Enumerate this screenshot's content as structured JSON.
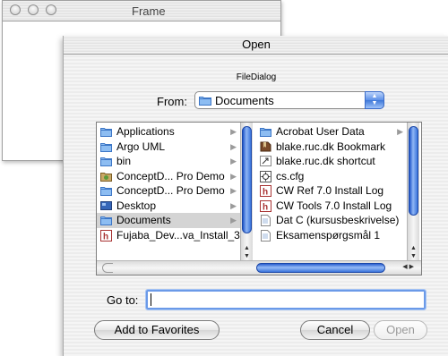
{
  "background_window": {
    "title": "Frame"
  },
  "dialog": {
    "title": "Open",
    "subtitle": "FileDialog",
    "from_label": "From:",
    "from_value": "Documents",
    "goto_label": "Go to:",
    "goto_value": "",
    "buttons": {
      "add_favorites": "Add to Favorites",
      "cancel": "Cancel",
      "open": "Open"
    }
  },
  "browser": {
    "column1": [
      {
        "label": "Applications",
        "icon": "folder-icon",
        "has_children": true
      },
      {
        "label": "Argo UML",
        "icon": "folder-icon",
        "has_children": true
      },
      {
        "label": "bin",
        "icon": "folder-icon",
        "has_children": true
      },
      {
        "label": "ConceptD... Pro Demo",
        "icon": "app-folder-icon",
        "has_children": true
      },
      {
        "label": "ConceptD... Pro Demo",
        "icon": "folder-icon",
        "has_children": true
      },
      {
        "label": "Desktop",
        "icon": "desktop-icon",
        "has_children": true
      },
      {
        "label": "Documents",
        "icon": "folder-icon",
        "has_children": true,
        "selected": true
      },
      {
        "label": "Fujaba_Dev...va_Install_3",
        "icon": "h-doc-icon",
        "has_children": false
      }
    ],
    "column2": [
      {
        "label": "Acrobat User Data",
        "icon": "folder-icon",
        "has_children": true
      },
      {
        "label": "blake.ruc.dk Bookmark",
        "icon": "bookmark-icon",
        "has_children": false
      },
      {
        "label": "blake.ruc.dk shortcut",
        "icon": "shortcut-icon",
        "has_children": false
      },
      {
        "label": "cs.cfg",
        "icon": "cfg-file-icon",
        "has_children": false
      },
      {
        "label": "CW Ref 7.0 Install Log",
        "icon": "h-doc-icon",
        "has_children": false
      },
      {
        "label": "CW Tools 7.0 Install Log",
        "icon": "h-doc-icon",
        "has_children": false
      },
      {
        "label": "Dat C (kursusbeskrivelse)",
        "icon": "document-icon",
        "has_children": false
      },
      {
        "label": "Eksamenspørgsmål 1",
        "icon": "document-icon",
        "has_children": false
      }
    ]
  },
  "colors": {
    "accent": "#3f78d8",
    "selection": "#d4d4d4",
    "folder": "#7fb1ee",
    "disabled_text": "#9a9a9a"
  }
}
